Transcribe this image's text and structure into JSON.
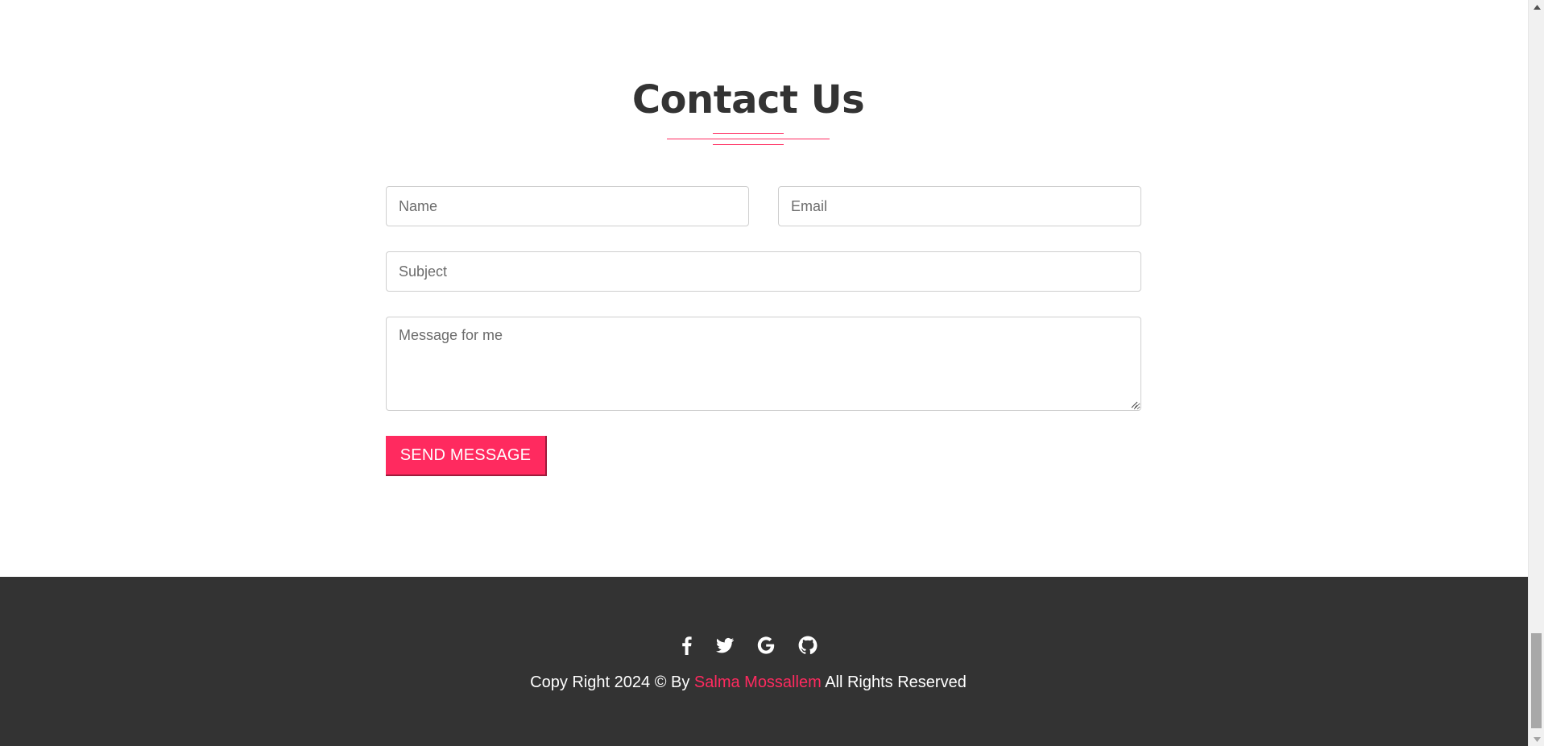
{
  "contact": {
    "title": "Contact Us",
    "name_placeholder": "Name",
    "email_placeholder": "Email",
    "subject_placeholder": "Subject",
    "message_placeholder": "Message for me",
    "send_label": "SEND MESSAGE"
  },
  "footer": {
    "social_icons": [
      "facebook-icon",
      "twitter-icon",
      "google-icon",
      "github-icon"
    ],
    "copyright_prefix": "Copy Right 2024 © By ",
    "author_name": "Salma Mossallem",
    "copyright_suffix": " All Rights Reserved"
  },
  "colors": {
    "accent": "#ff2a5f",
    "heading": "#333333",
    "footer_bg": "#333333",
    "footer_text": "#ffffff"
  }
}
